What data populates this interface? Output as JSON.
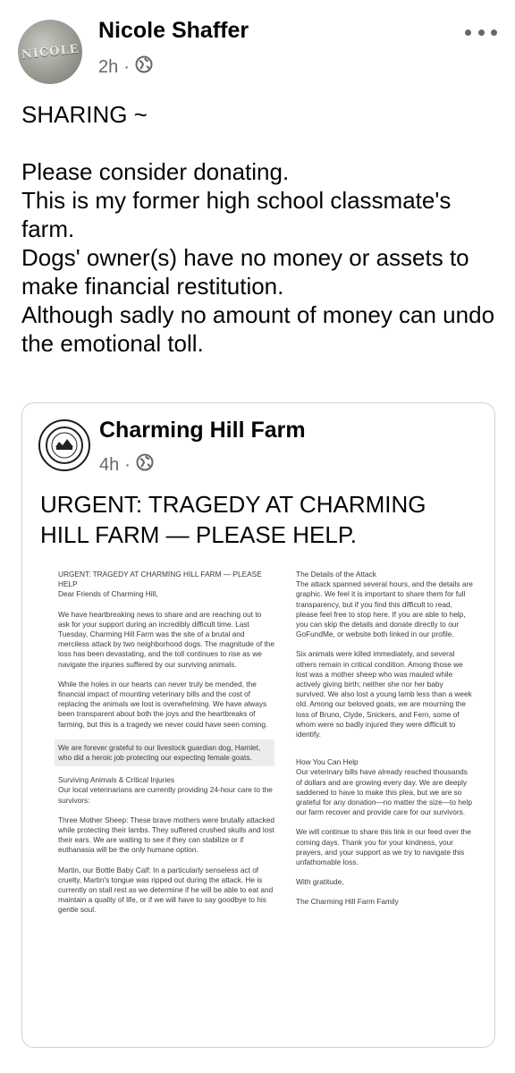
{
  "post": {
    "author": "Nicole Shaffer",
    "avatar_text": "NICOLE",
    "time": "2h",
    "separator": "·",
    "text": "SHARING ~\n\nPlease consider donating.\nThis is my former high school classmate's farm.\nDogs' owner(s) have no money or assets to make financial restitution.\nAlthough sadly no amount of money can undo the emotional toll."
  },
  "shared": {
    "page_name": "Charming Hill Farm",
    "time": "4h",
    "separator": "·",
    "title": "URGENT: TRAGEDY AT CHARMING HILL FARM — PLEASE HELP.",
    "letter_left": [
      "URGENT: TRAGEDY AT CHARMING HILL FARM — PLEASE HELP",
      "Dear Friends of Charming Hill,",
      "We have heartbreaking news to share and are reaching out to ask for your support during an incredibly difficult time. Last Tuesday, Charming Hill Farm was the site of a brutal and merciless attack by two neighborhood dogs. The magnitude of the loss has been devastating, and the toll continues to rise as we navigate the injuries suffered by our surviving animals.",
      "While the holes in our hearts can never truly be mended, the financial impact of mounting veterinary bills and the cost of replacing the animals we lost is overwhelming. We have always been transparent about both the joys and the heartbreaks of farming, but this is a tragedy we never could have seen coming.",
      "We are forever grateful to our livestock guardian dog, Hamlet, who did a heroic job protecting our expecting female goats.",
      "Surviving Animals & Critical Injuries",
      "Our local veterinarians are currently providing 24-hour care to the survivors:",
      "Three Mother Sheep: These brave mothers were brutally attacked while protecting their lambs. They suffered crushed skulls and lost their ears. We are waiting to see if they can stabilize or if euthanasia will be the only humane option.",
      "Martin, our Bottle Baby Calf: In a particularly senseless act of cruelty, Martin's tongue was ripped out during the attack. He is currently on stall rest as we determine if he will be able to eat and maintain a quality of life, or if we will have to say goodbye to his gentle soul."
    ],
    "letter_right": [
      "The Details of the Attack",
      "The attack spanned several hours, and the details are graphic. We feel it is important to share them for full transparency, but if you find this difficult to read, please feel free to stop here. If you are able to help, you can skip the details and donate directly to our GoFundMe, or website both linked in our profile.",
      "Six animals were killed immediately, and several others remain in critical condition. Among those we lost was a mother sheep who was mauled while actively giving birth; neither she nor her baby survived. We also lost a young lamb less than a week old. Among our beloved goats, we are mourning the loss of Bruno, Clyde, Snickers, and Fern, some of whom were so badly injured they were difficult to identify.",
      "How You Can Help",
      "Our veterinary bills have already reached thousands of dollars and are growing every day. We are deeply saddened to have to make this plea, but we are so grateful for any donation—no matter the size—to help our farm recover and provide care for our survivors.",
      "We will continue to share this link in our feed over the coming days. Thank you for your kindness, your prayers, and your support as we try to navigate this unfathomable loss.",
      "With gratitude,",
      "The Charming Hill Farm Family"
    ]
  },
  "icons": {
    "privacy": "globe-icon",
    "menu": "more-options-icon"
  },
  "colors": {
    "meta_gray": "#65676b",
    "text": "#050505",
    "border": "#ced0d4"
  }
}
